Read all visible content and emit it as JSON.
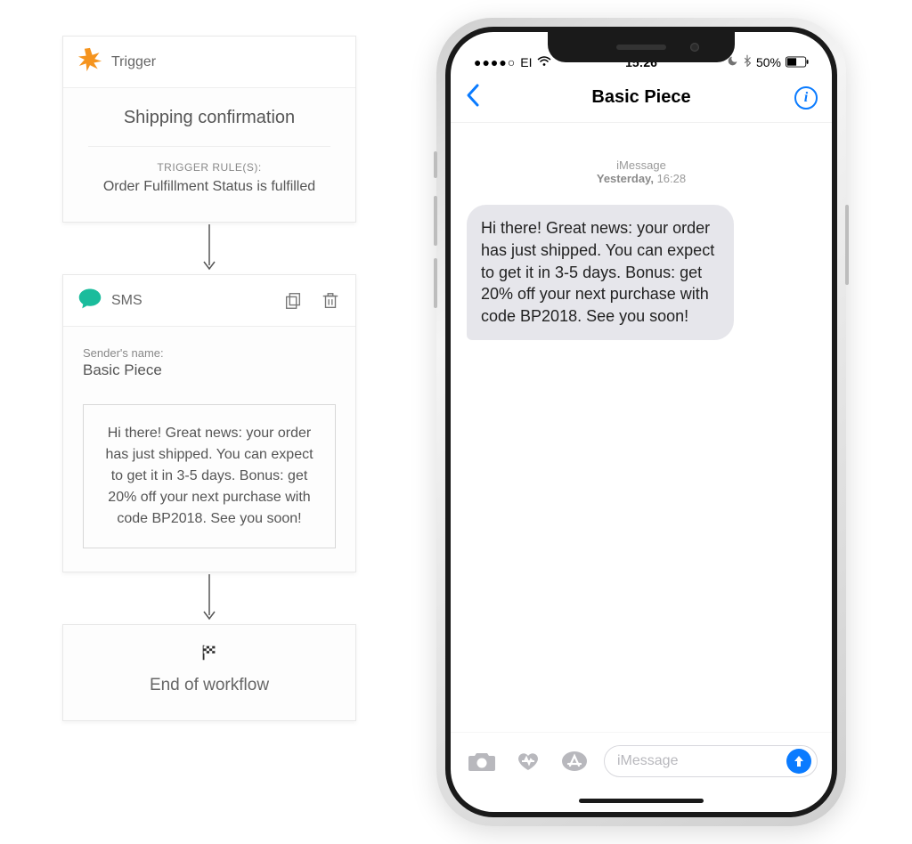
{
  "workflow": {
    "trigger": {
      "header_label": "Trigger",
      "name": "Shipping confirmation",
      "rules_label": "TRIGGER RULE(S):",
      "rule": "Order Fulfillment Status is fulfilled"
    },
    "sms": {
      "header_label": "SMS",
      "sender_label": "Sender's name:",
      "sender_name": "Basic Piece",
      "message": "Hi there! Great news: your order has just shipped. You can expect to get it in 3-5 days. Bonus: get 20% off your next purchase with code BP2018. See you soon!"
    },
    "end_label": "End of workflow"
  },
  "phone": {
    "status": {
      "signal_dots": "●●●●○",
      "carrier": "EI",
      "wifi": "≈",
      "time": "15:26",
      "battery_pct": "50%"
    },
    "nav": {
      "title": "Basic Piece"
    },
    "chat": {
      "service": "iMessage",
      "timestamp_day": "Yesterday,",
      "timestamp_time": "16:28",
      "bubble": "Hi there! Great news: your order has just shipped. You can expect to get it in 3-5 days. Bonus: get 20% off your next purchase with code BP2018. See you soon!"
    },
    "compose": {
      "placeholder": "iMessage"
    }
  }
}
